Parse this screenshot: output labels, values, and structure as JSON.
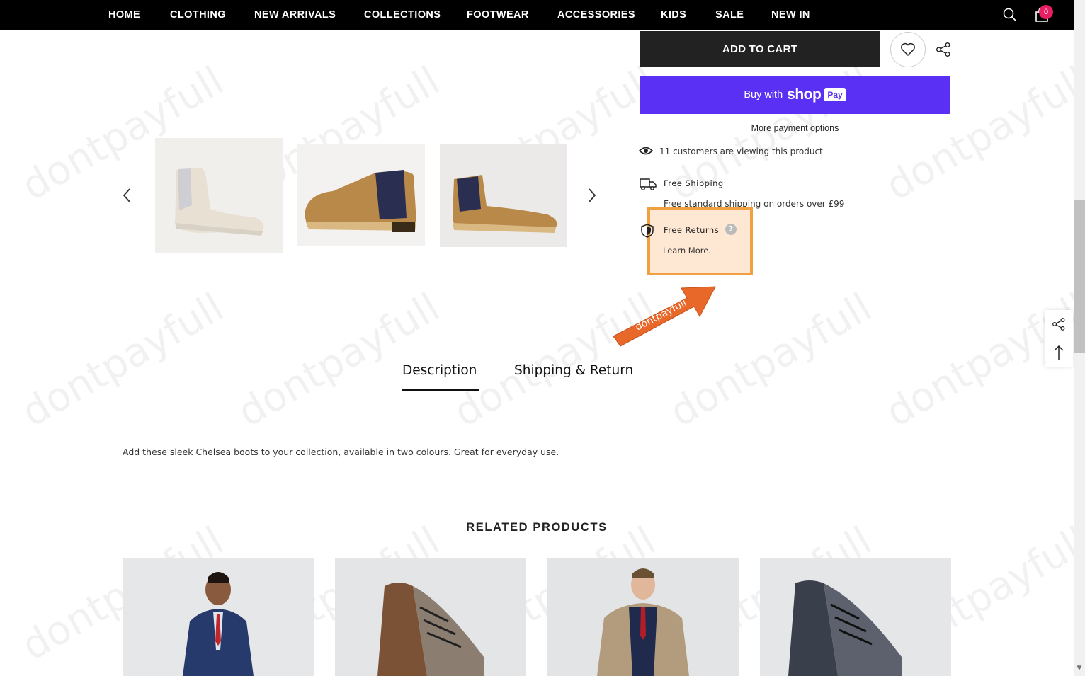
{
  "nav": {
    "items": [
      "HOME",
      "CLOTHING",
      "NEW ARRIVALS",
      "COLLECTIONS",
      "FOOTWEAR",
      "ACCESSORIES",
      "KIDS",
      "SALE",
      "NEW IN"
    ],
    "cart_count": "0"
  },
  "product": {
    "add_to_cart_label": "ADD TO CART",
    "buy_with_label": "Buy with",
    "shop_label": "shop",
    "pay_label": "Pay",
    "more_payment_label": "More payment options",
    "viewers_text": "11 customers are viewing this product",
    "shipping_title": "Free Shipping",
    "shipping_text": "Free standard shipping on orders over £99",
    "returns_title": "Free Returns",
    "returns_link": "Learn More.",
    "help_mark": "?"
  },
  "tabs": [
    {
      "label": "Description",
      "active": true
    },
    {
      "label": "Shipping & Return",
      "active": false
    }
  ],
  "description_text": "Add these sleek Chelsea boots to your collection, available in two colours. Great for everyday use.",
  "related_title": "RELATED PRODUCTS",
  "watermark_text": "dontpayfull",
  "promo_arrow_text": "dontpayfull",
  "colors": {
    "nav_bg": "#000000",
    "shop_pay": "#5a31f4",
    "highlight": "#f0a040",
    "arrow": "#e8682a",
    "cart_badge": "#e91e63"
  }
}
